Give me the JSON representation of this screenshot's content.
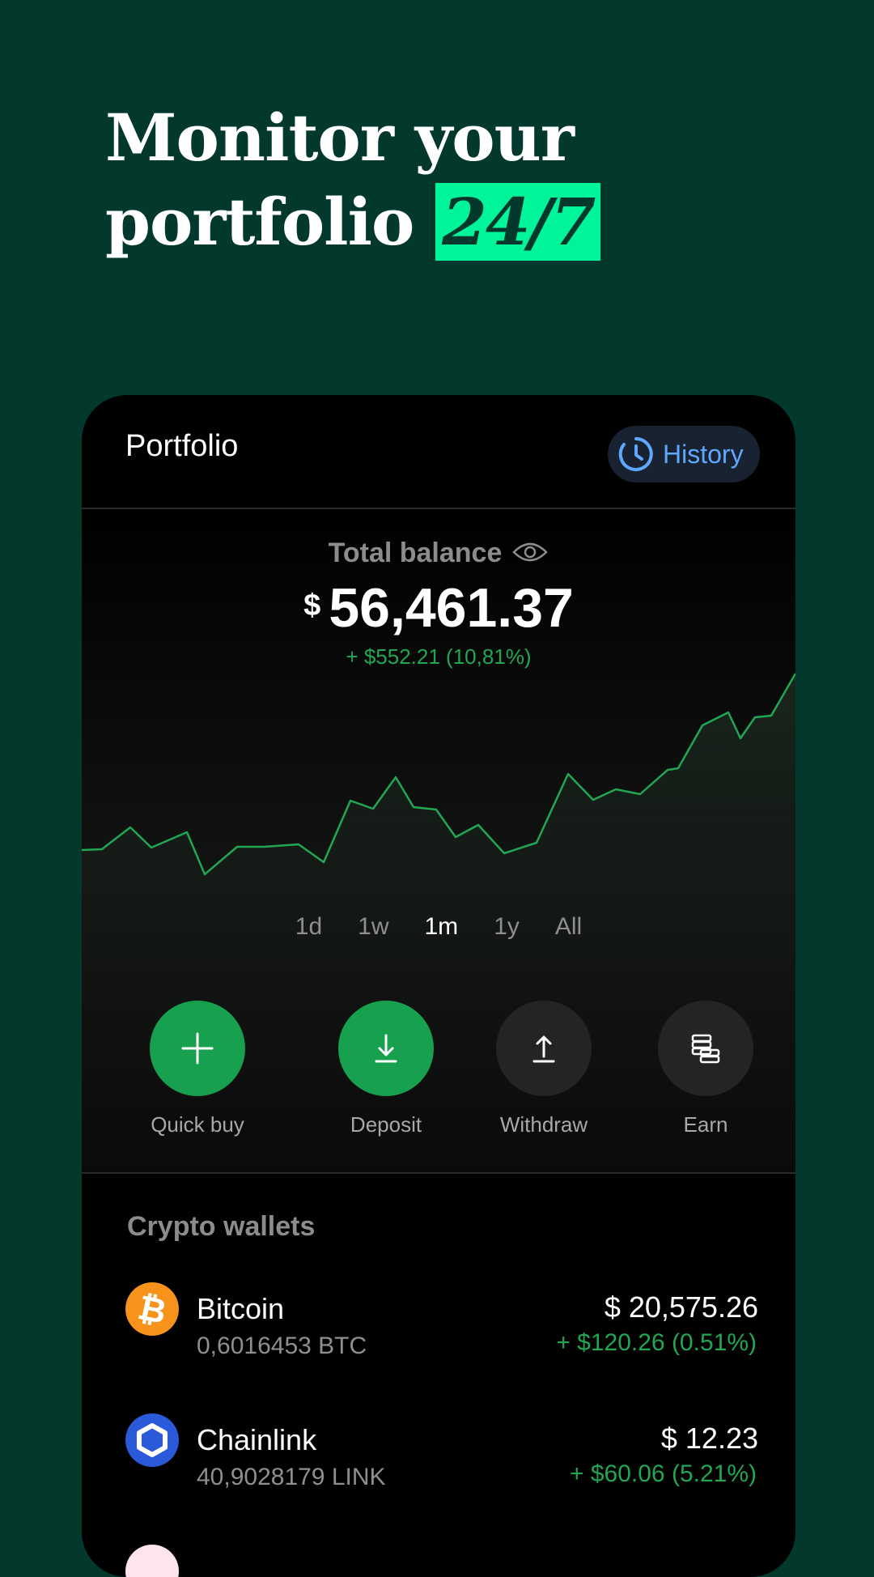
{
  "headline": {
    "line1": "Monitor your",
    "line2": "portfolio",
    "highlight": "24/7"
  },
  "portfolio": {
    "title": "Portfolio",
    "history_label": "History",
    "balance_label": "Total balance",
    "currency_symbol": "$",
    "balance": "56,461.37",
    "change": "+ $552.21 (10,81%)"
  },
  "ranges": [
    "1d",
    "1w",
    "1m",
    "1y",
    "All"
  ],
  "active_range": "1m",
  "actions": [
    {
      "label": "Quick buy",
      "icon": "plus-icon"
    },
    {
      "label": "Deposit",
      "icon": "download-icon"
    },
    {
      "label": "Withdraw",
      "icon": "upload-icon"
    },
    {
      "label": "Earn",
      "icon": "stack-icon"
    }
  ],
  "wallets": {
    "title": "Crypto wallets",
    "items": [
      {
        "name": "Bitcoin",
        "amount": "0,6016453 BTC",
        "value": "$ 20,575.26",
        "change": "+ $120.26 (0.51%)",
        "icon": "bitcoin-icon",
        "color": "#f7931a"
      },
      {
        "name": "Chainlink",
        "amount": "40,9028179 LINK",
        "value": "$ 12.23",
        "change": "+ $60.06 (5.21%)",
        "icon": "chainlink-icon",
        "color": "#2a5ada"
      }
    ]
  },
  "colors": {
    "background": "#03382d",
    "accent": "#00f59a",
    "positive": "#22a653",
    "history": "#5ea8ff"
  }
}
